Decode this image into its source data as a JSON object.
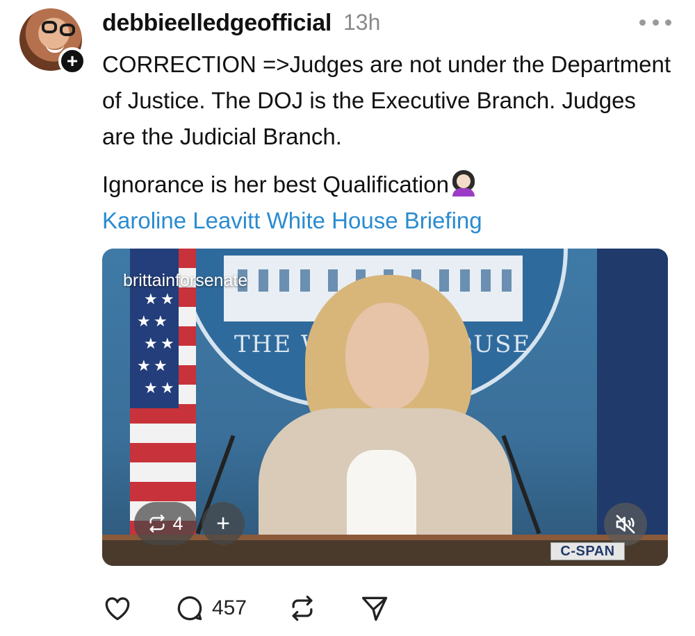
{
  "post": {
    "username": "debbieelledgeofficial",
    "time": "13h",
    "body": "CORRECTION =>Judges are not under the Department of Justice. The DOJ is the Executive Branch. Judges are the Judicial Branch.",
    "line2": "Ignorance is her best Qualification",
    "link_text": "Karoline Leavitt White House Briefing",
    "follow_symbol": "+"
  },
  "video": {
    "channel": "brittainforsenate",
    "seal_left": "THE WH",
    "seal_right": "OUSE",
    "repost_count": "4",
    "add_symbol": "+",
    "network": "C-SPAN"
  },
  "actions": {
    "like_icon": "heart-icon",
    "reply_icon": "comment-icon",
    "reply_count": "457",
    "repost_icon": "repost-icon",
    "share_icon": "send-icon"
  },
  "colors": {
    "link": "#2a8bd0",
    "time": "#8a8a8a",
    "cspan_text": "#213a68"
  }
}
